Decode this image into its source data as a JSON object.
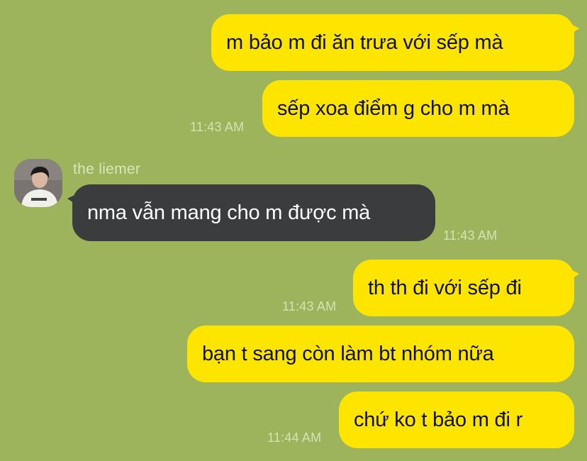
{
  "colors": {
    "background": "#9db35c",
    "outgoing_bubble": "#fee500",
    "incoming_bubble": "#3b3c3e",
    "timestamp": "#d6e2b3"
  },
  "messages": [
    {
      "direction": "outgoing",
      "text": "m bảo m đi ăn trưa với sếp mà"
    },
    {
      "direction": "outgoing",
      "text": "sếp xoa điểm g cho m mà",
      "time": "11:43 AM"
    },
    {
      "direction": "incoming",
      "sender": "the liemer",
      "avatar_icon": "profile-photo",
      "text": "nma vẫn mang cho m được mà",
      "time": "11:43 AM"
    },
    {
      "direction": "outgoing",
      "text": "th th đi với sếp đi",
      "time": "11:43 AM"
    },
    {
      "direction": "outgoing",
      "text": "bạn t sang còn làm bt nhóm nữa"
    },
    {
      "direction": "outgoing",
      "text": "chứ ko t bảo m đi r",
      "time": "11:44 AM"
    }
  ]
}
